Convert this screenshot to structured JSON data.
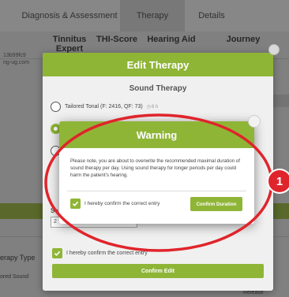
{
  "tabs": {
    "diagnosis": "Diagnosis & Assessment",
    "therapy": "Therapy",
    "details": "Details"
  },
  "columns": {
    "tinnitus_expert": "Tinnitus Expert",
    "thi_score": "THI-Score",
    "hearing_aid": "Hearing Aid",
    "journey": "Journey"
  },
  "background": {
    "id_line1": "13b99fc9",
    "id_line2": "ng-ug.com",
    "therapy_type": "erapy Type",
    "stored_sound": "ored Sound",
    "release": "Release"
  },
  "edit_modal": {
    "title": "Edit Therapy",
    "section_title": "Sound Therapy",
    "option1_label": "Tailored Tonal (F: 2416, QF: 73)",
    "option1_tag": "6 h",
    "select_label": "Se",
    "input_value": "2",
    "confirm_label": "I hereby confirm the correct entry",
    "confirm_button": "Confirm Edit"
  },
  "warning_modal": {
    "title": "Warning",
    "message": "Please note, you are about to overwrite the recommended maximal duration of sound therapy per day. Using sound therapy for longer periods per day could harm the patient's hearing.",
    "confirm_label": "I hereby confirm the correct entry",
    "confirm_button": "Confirm Duration"
  },
  "annotation": {
    "badge": "1"
  },
  "colors": {
    "accent_green": "#8fb537",
    "annotation_red": "#e0242b"
  }
}
